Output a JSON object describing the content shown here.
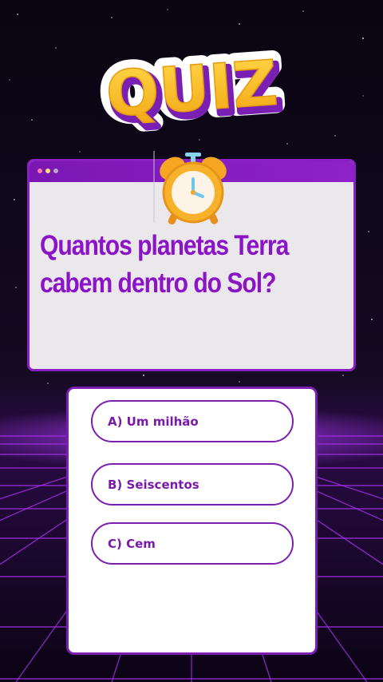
{
  "logo": {
    "text": "QUIZ"
  },
  "question": {
    "line1": "Quantos planetas Terra",
    "line2": "cabem dentro do Sol?"
  },
  "answers": [
    {
      "label": "A) Um milhão"
    },
    {
      "label": "B) Seiscentos"
    },
    {
      "label": "C) Cem"
    }
  ],
  "colors": {
    "accent": "#8a14c6",
    "logo_yellow": "#f7b718",
    "background": "#0d0616"
  }
}
